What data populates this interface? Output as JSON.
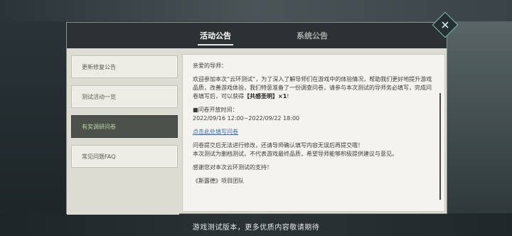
{
  "tabs": [
    {
      "label": "活动公告",
      "active": true
    },
    {
      "label": "系统公告",
      "active": false
    }
  ],
  "sidebar": {
    "items": [
      {
        "label": "更新修复公告",
        "active": false
      },
      {
        "label": "测试活动一览",
        "active": false
      },
      {
        "label": "有奖调研问卷",
        "active": true
      },
      {
        "label": "常见问题FAQ",
        "active": false
      }
    ]
  },
  "content": {
    "greeting": "亲爱的导师：",
    "body_part1": "欢迎参加本次“云环测试”，为了深入了解导师们在游戏中的体验情况，帮助我们更好地提升游戏品质，改善游戏体验，我们特意准备了一份调查问卷，请参与本次测试的导师务必填写，完成问卷填写后，可以获得",
    "reward": "【共感圣明】×1",
    "body_end": "!",
    "time_title": "■问卷开放时间：",
    "time_range": "2022/09/16 12:00~2022/09/22 18:00",
    "link": "点击此处填写问卷",
    "note1": "问卷提交后无法进行修改，还请导师确认填写内容无误后再提交哦！",
    "note2": "本次测试为删档测试，不代表游戏最终品质，希望导师能够积极提供建议与意见。",
    "thanks": "感谢您对本次云环测试的支持！",
    "signature": "《斯露德》项目团队"
  },
  "footer": {
    "caption": "游戏测试版本，更多优质内容敬请期待"
  },
  "icons": {
    "close": "close-icon"
  }
}
